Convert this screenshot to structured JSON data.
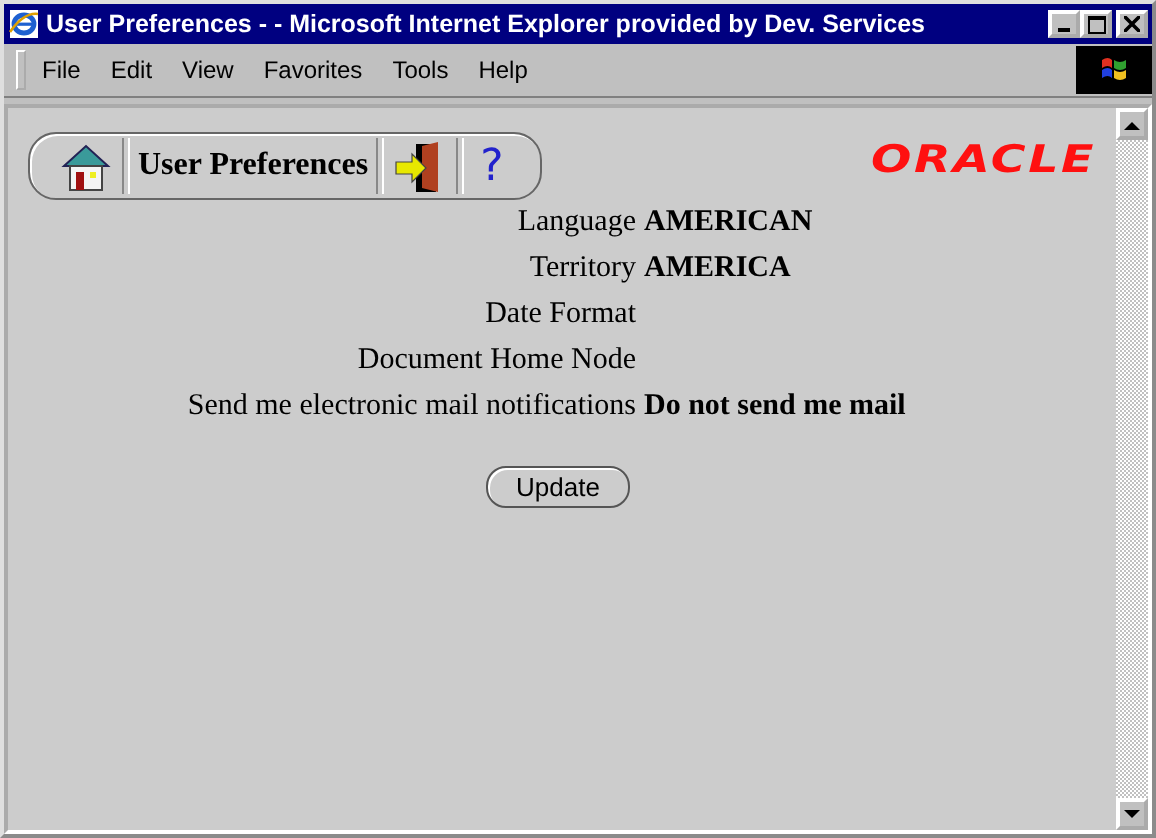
{
  "window": {
    "title": "User Preferences - - Microsoft Internet Explorer provided by Dev. Services"
  },
  "menu": [
    "File",
    "Edit",
    "View",
    "Favorites",
    "Tools",
    "Help"
  ],
  "toolbar": {
    "title": "User Preferences",
    "help": "?"
  },
  "logo": "ORACLE",
  "fields": [
    {
      "label": "Language",
      "value": "AMERICAN"
    },
    {
      "label": "Territory",
      "value": "AMERICA"
    },
    {
      "label": "Date Format"
    },
    {
      "label": "Document Home Node"
    },
    {
      "label": "Send me electronic mail notifications",
      "value": "Do not send me mail"
    }
  ],
  "button": "Update"
}
